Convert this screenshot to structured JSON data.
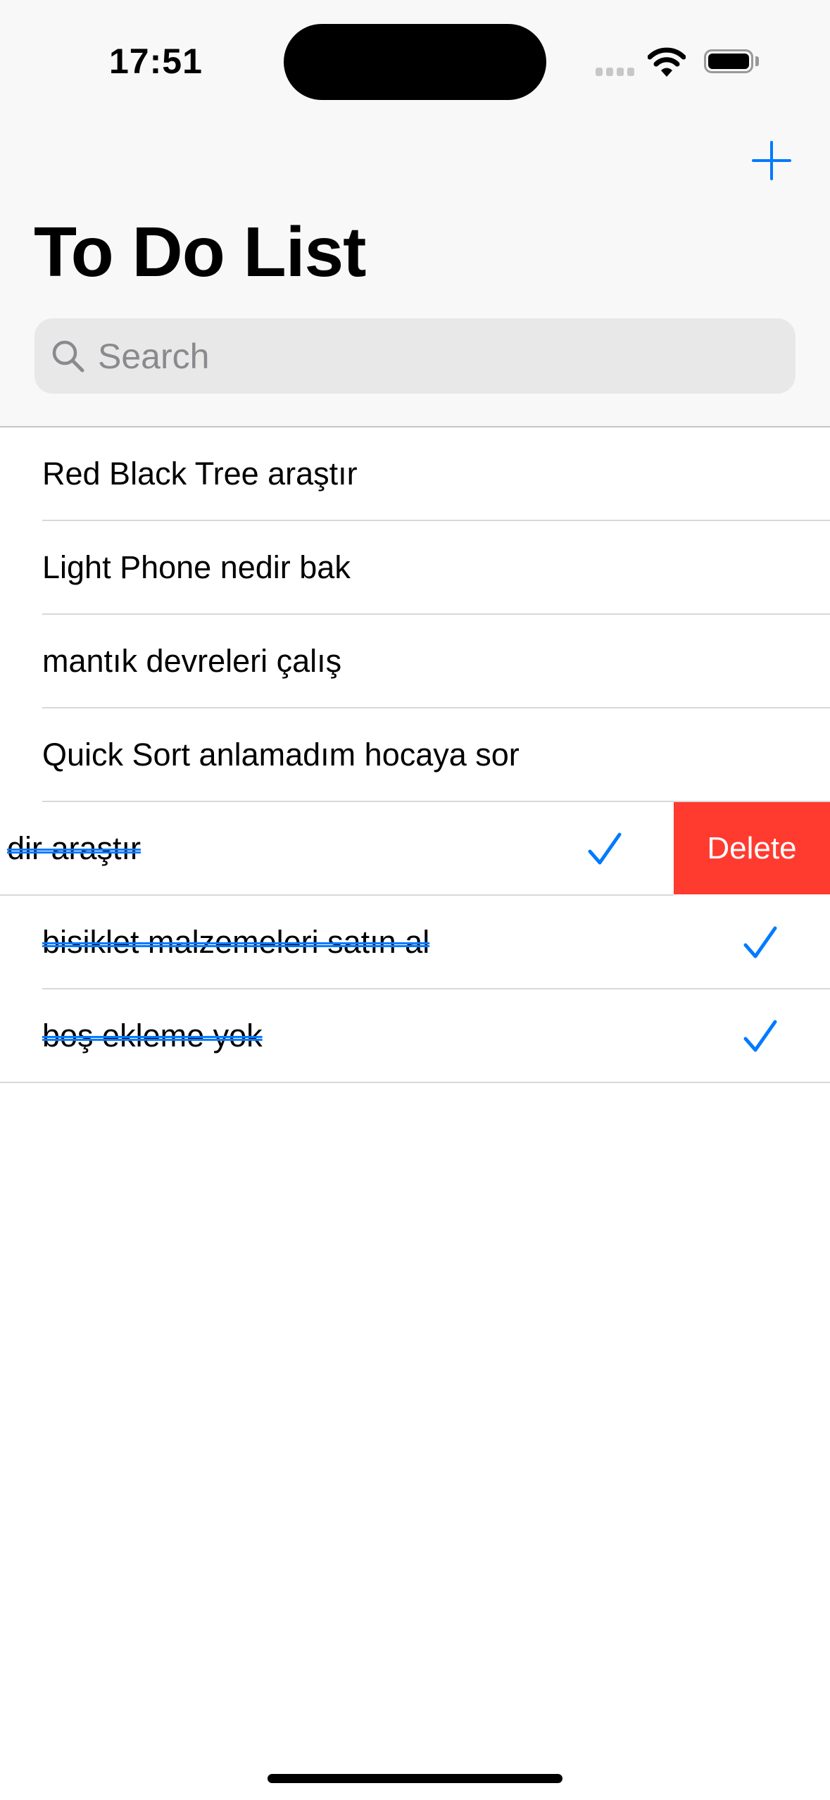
{
  "status_bar": {
    "time": "17:51",
    "wifi_icon": "wifi-icon",
    "battery_icon": "battery-icon"
  },
  "nav": {
    "title": "To Do List",
    "add_icon": "plus-icon"
  },
  "search": {
    "placeholder": "Search",
    "value": ""
  },
  "colors": {
    "accent": "#007aff",
    "delete": "#ff3b30",
    "header_bg": "#f8f8f8"
  },
  "items": [
    {
      "text": "Red Black Tree araştır",
      "done": false
    },
    {
      "text": "Light Phone nedir bak",
      "done": false
    },
    {
      "text": "mantık devreleri çalış",
      "done": false
    },
    {
      "text": "Quick Sort anlamadım hocaya sor",
      "done": false
    },
    {
      "text": "dir araştır",
      "done": true,
      "swiped": true
    },
    {
      "text": "bisiklet malzemeleri satın al",
      "done": true
    },
    {
      "text": "boş ekleme yok",
      "done": true
    }
  ],
  "swipe_action": {
    "label": "Delete"
  }
}
